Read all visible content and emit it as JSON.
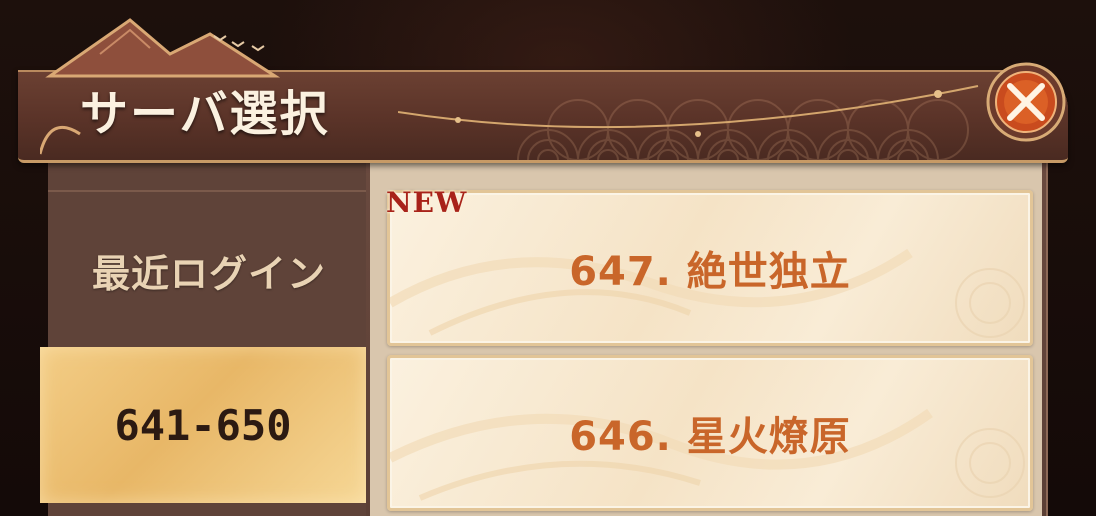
{
  "header": {
    "title": "サーバ選択"
  },
  "sidebar": {
    "recent_label": "最近ログイン",
    "range_label": "641-650"
  },
  "servers": [
    {
      "label": "647. 絶世独立",
      "badge": "NEW"
    },
    {
      "label": "646. 星火燎原"
    }
  ],
  "icons": {
    "close": "close-x-icon"
  },
  "colors": {
    "accent_orange": "#c9662a",
    "badge_red": "#a8231a",
    "selected_gold": "#e8b767"
  }
}
